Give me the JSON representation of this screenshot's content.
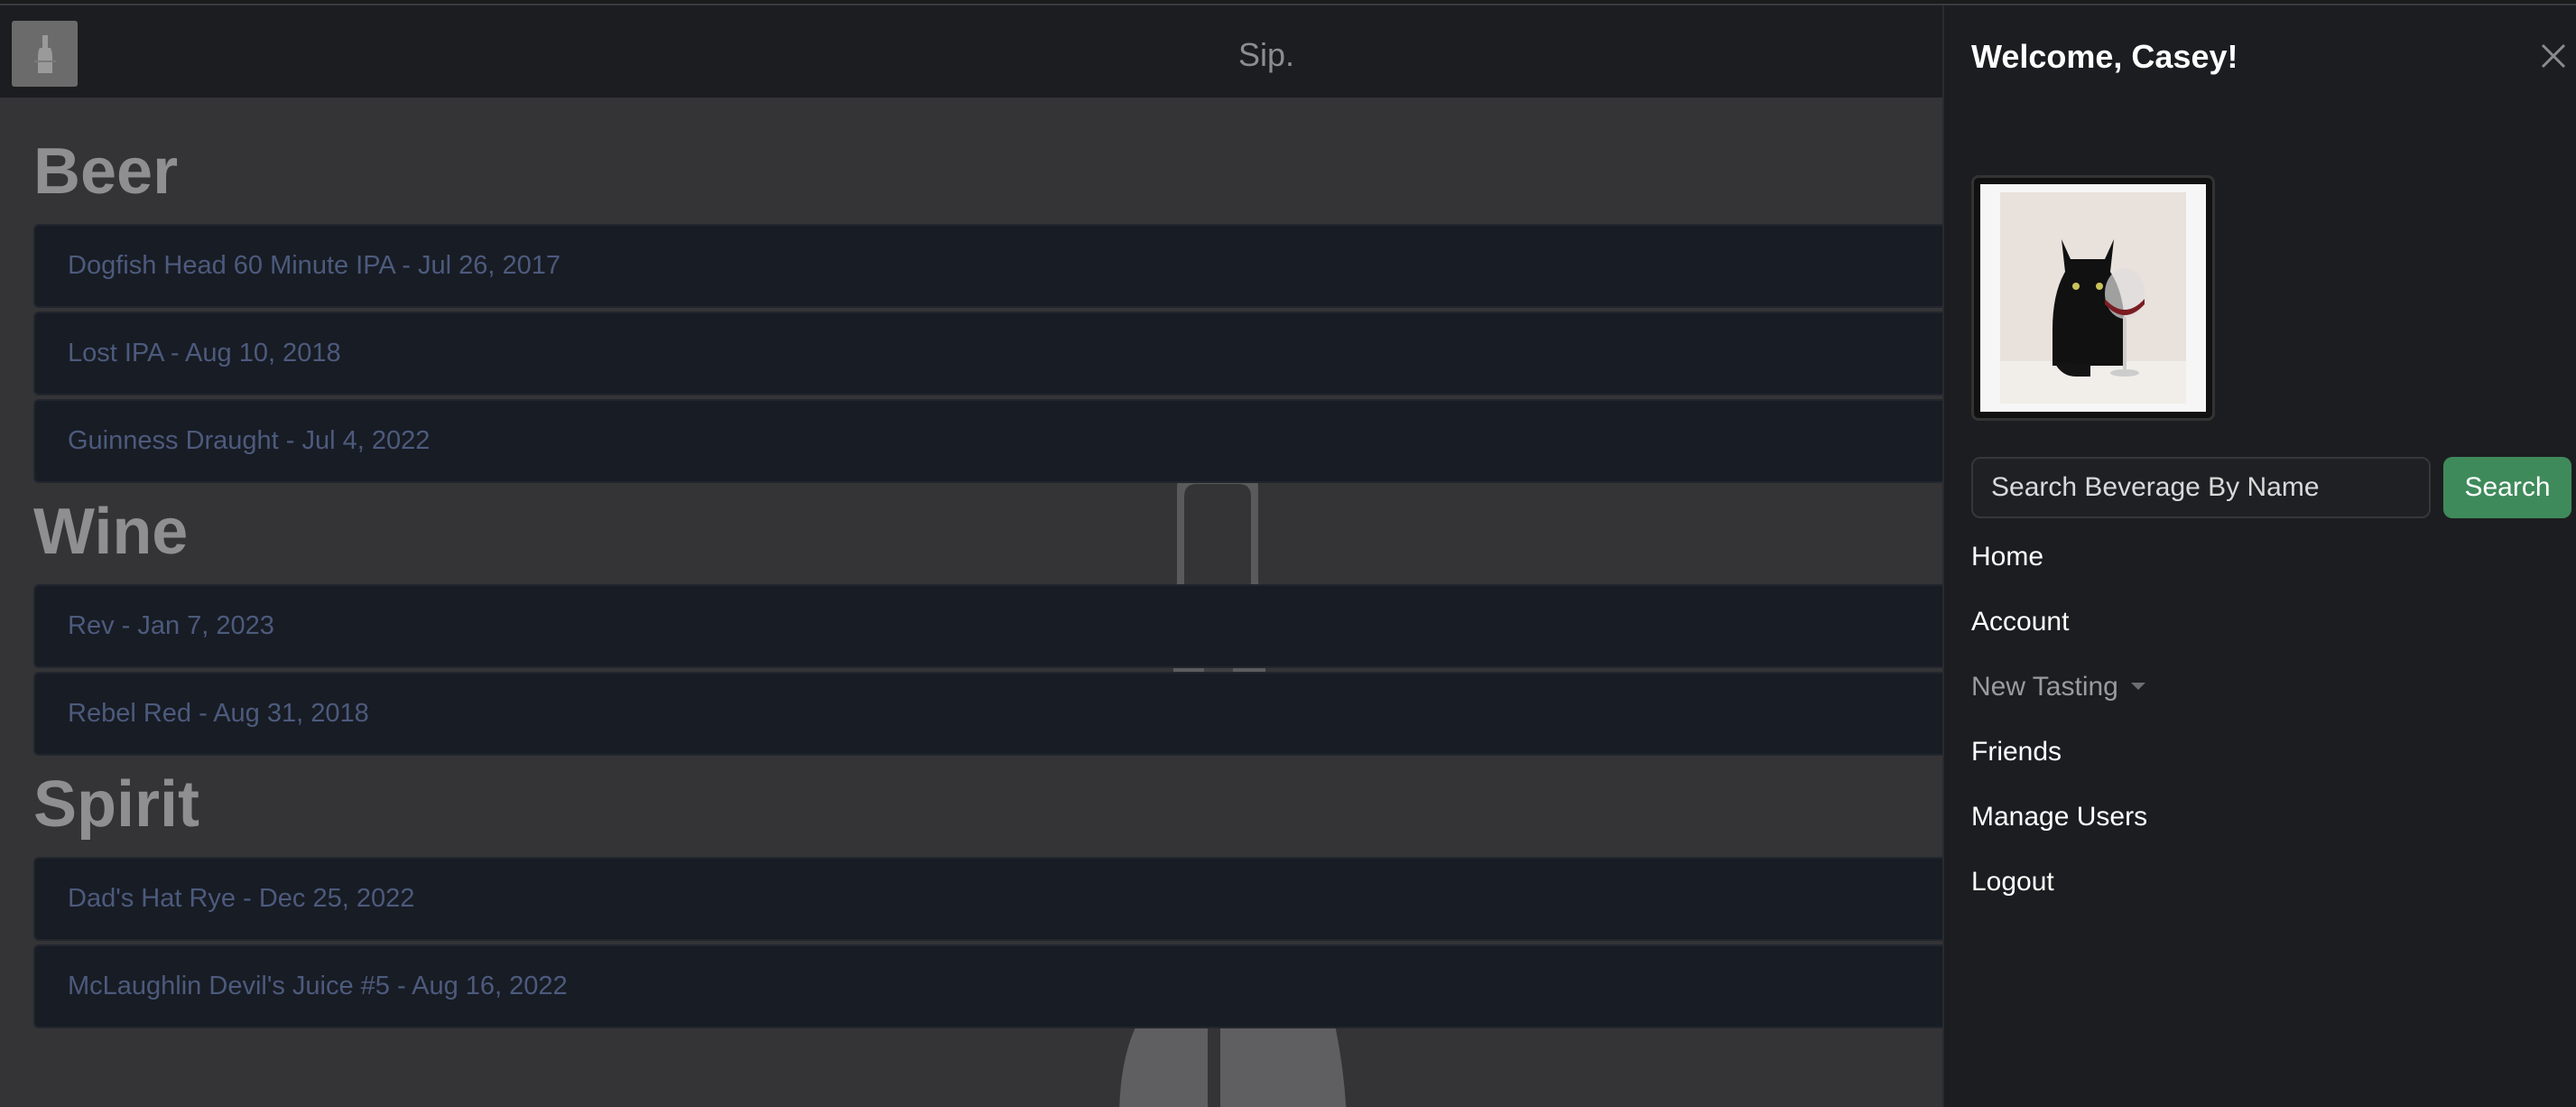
{
  "navbar": {
    "brand": "Sip.",
    "logo_icon": "wine-bottle-logo-icon"
  },
  "sections": [
    {
      "title": "Beer",
      "items": [
        "Dogfish Head 60 Minute IPA - Jul 26, 2017",
        "Lost IPA - Aug 10, 2018",
        "Guinness Draught - Jul 4, 2022"
      ]
    },
    {
      "title": "Wine",
      "items": [
        "Rev - Jan 7, 2023",
        "Rebel Red - Aug 31, 2018"
      ]
    },
    {
      "title": "Spirit",
      "items": [
        "Dad's Hat Rye - Dec 25, 2022",
        "McLaughlin Devil's Juice #5 - Aug 16, 2022"
      ]
    }
  ],
  "offcanvas": {
    "title": "Welcome, Casey!",
    "close_icon": "close-icon",
    "avatar_icon": "black-cat-with-wine-glass-avatar",
    "search": {
      "placeholder": "Search Beverage By Name",
      "button_label": "Search"
    },
    "nav": {
      "home": "Home",
      "account": "Account",
      "new_tasting": "New Tasting",
      "friends": "Friends",
      "manage_users": "Manage Users",
      "logout": "Logout"
    }
  },
  "colors": {
    "search_button": "#3f8a5b",
    "panel_bg": "#1c1d20",
    "item_bg": "#181c24",
    "item_text": "#4c5a7d"
  }
}
